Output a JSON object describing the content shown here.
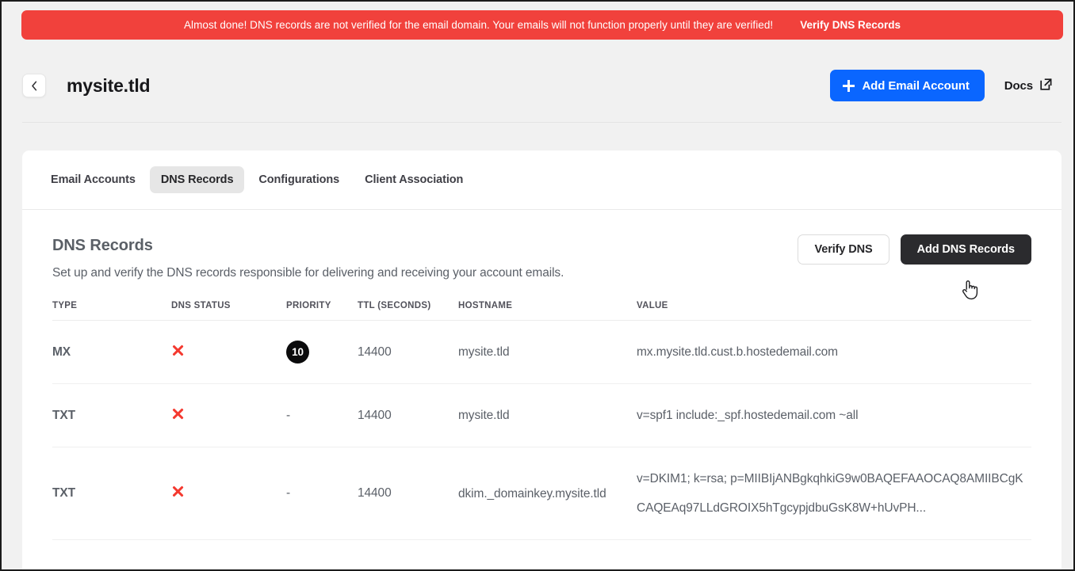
{
  "alert": {
    "message": "Almost done! DNS records are not verified for the email domain. Your emails will not function properly until they are verified!",
    "action_label": "Verify DNS Records",
    "color": "#f1413c"
  },
  "header": {
    "back_icon": "chevron-left-icon",
    "title": "mysite.tld",
    "add_email_label": "Add Email Account",
    "add_email_color": "#0a66ff",
    "docs_label": "Docs",
    "docs_icon": "external-link-icon"
  },
  "tabs": [
    {
      "label": "Email Accounts",
      "active": false
    },
    {
      "label": "DNS Records",
      "active": true
    },
    {
      "label": "Configurations",
      "active": false
    },
    {
      "label": "Client Association",
      "active": false
    }
  ],
  "section": {
    "title": "DNS Records",
    "subtitle": "Set up and verify the DNS records responsible for delivering and receiving your account emails.",
    "verify_label": "Verify DNS",
    "add_label": "Add DNS Records"
  },
  "table": {
    "columns": [
      "TYPE",
      "DNS STATUS",
      "PRIORITY",
      "TTL (SECONDS)",
      "HOSTNAME",
      "VALUE"
    ],
    "rows": [
      {
        "type": "MX",
        "status_icon": "red-x-icon",
        "status": "unverified",
        "priority": "10",
        "priority_is_badge": true,
        "ttl": "14400",
        "hostname": "mysite.tld",
        "value": "mx.mysite.tld.cust.b.hostedemail.com"
      },
      {
        "type": "TXT",
        "status_icon": "red-x-icon",
        "status": "unverified",
        "priority": "-",
        "priority_is_badge": false,
        "ttl": "14400",
        "hostname": "mysite.tld",
        "value": "v=spf1 include:_spf.hostedemail.com ~all"
      },
      {
        "type": "TXT",
        "status_icon": "red-x-icon",
        "status": "unverified",
        "priority": "-",
        "priority_is_badge": false,
        "ttl": "14400",
        "hostname": "dkim._domainkey.mysite.tld",
        "value": "v=DKIM1; k=rsa; p=MIIBIjANBgkqhkiG9w0BAQEFAAOCAQ8AMIIBCgKCAQEAq97LLdGROIX5hTgcypjdbuGsK8W+hUvPH..."
      }
    ]
  },
  "cursor": {
    "icon": "pointing-hand-cursor"
  }
}
